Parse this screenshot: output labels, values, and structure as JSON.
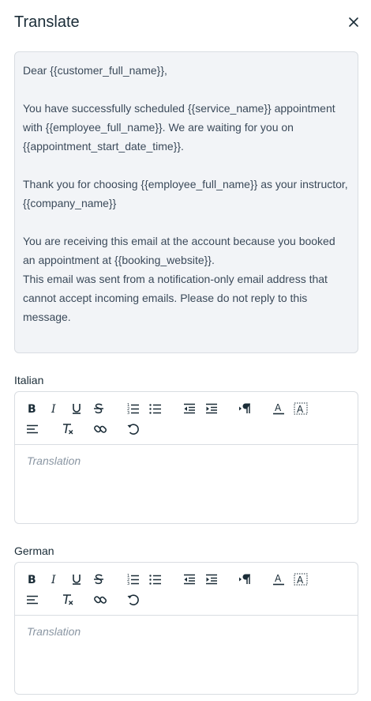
{
  "header": {
    "title": "Translate"
  },
  "original": {
    "paragraphs": [
      "Dear {{customer_full_name}},",
      "You have successfully scheduled {{service_name}} appointment with {{employee_full_name}}. We are waiting for you on {{appointment_start_date_time}}.",
      "Thank you for choosing {{employee_full_name}} as your instructor,\n{{company_name}}",
      "You are receiving this email at the account because you booked an appointment at {{booking_website}}.\nThis email was sent from a notification-only email address that cannot accept incoming emails. Please do not reply to this message."
    ]
  },
  "editors": [
    {
      "label": "Italian",
      "placeholder": "Translation"
    },
    {
      "label": "German",
      "placeholder": "Translation"
    }
  ],
  "colors": {
    "accent_text": "#1a2c37",
    "border": "#d9dde2",
    "panel_bg": "#f2f4f7"
  }
}
